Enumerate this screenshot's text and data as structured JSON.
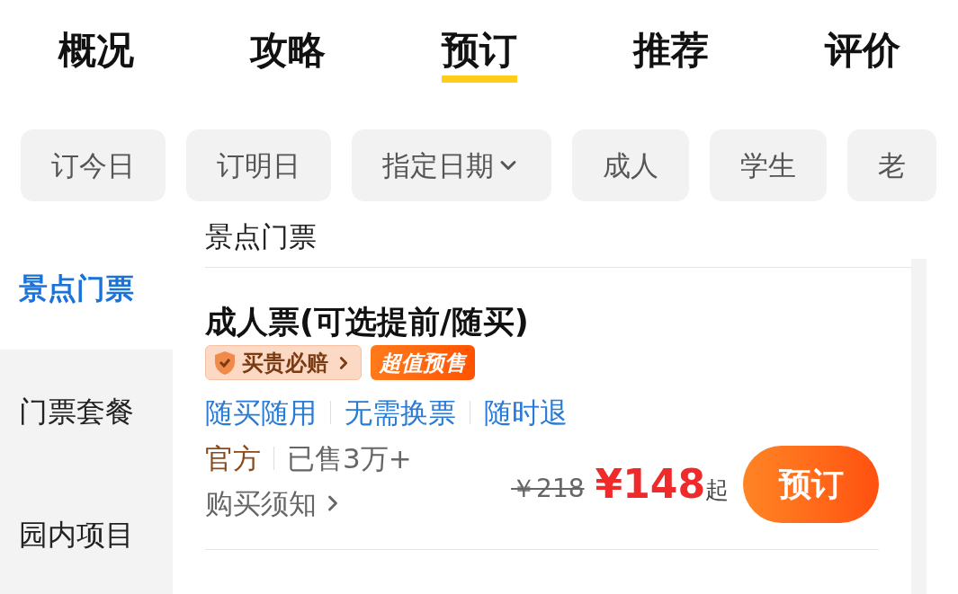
{
  "tabs": [
    {
      "label": "概况",
      "selected": false
    },
    {
      "label": "攻略",
      "selected": false
    },
    {
      "label": "预订",
      "selected": true
    },
    {
      "label": "推荐",
      "selected": false
    },
    {
      "label": "评价",
      "selected": false
    }
  ],
  "filters": [
    {
      "label": "订今日",
      "dropdown": false
    },
    {
      "label": "订明日",
      "dropdown": false
    },
    {
      "label": "指定日期",
      "dropdown": true
    },
    {
      "label": "成人",
      "dropdown": false
    },
    {
      "label": "学生",
      "dropdown": false
    },
    {
      "label": "老",
      "dropdown": false
    }
  ],
  "sidebar": {
    "items": [
      {
        "label": "景点门票",
        "selected": true
      },
      {
        "label": "门票套餐",
        "selected": false
      },
      {
        "label": "园内项目",
        "selected": false
      }
    ]
  },
  "section_title": "景点门票",
  "product": {
    "title": "成人票(可选提前/随买)",
    "badges": [
      {
        "kind": "guarantee",
        "label": "买贵必赔"
      },
      {
        "kind": "promo",
        "label": "超值预售"
      }
    ],
    "features": [
      "随买随用",
      "无需换票",
      "随时退"
    ],
    "seller": "官方",
    "sold": "已售3万+",
    "notice": "购买须知",
    "original_price": "￥218",
    "price": "¥148",
    "price_suffix": "起",
    "book_button": "预订"
  }
}
